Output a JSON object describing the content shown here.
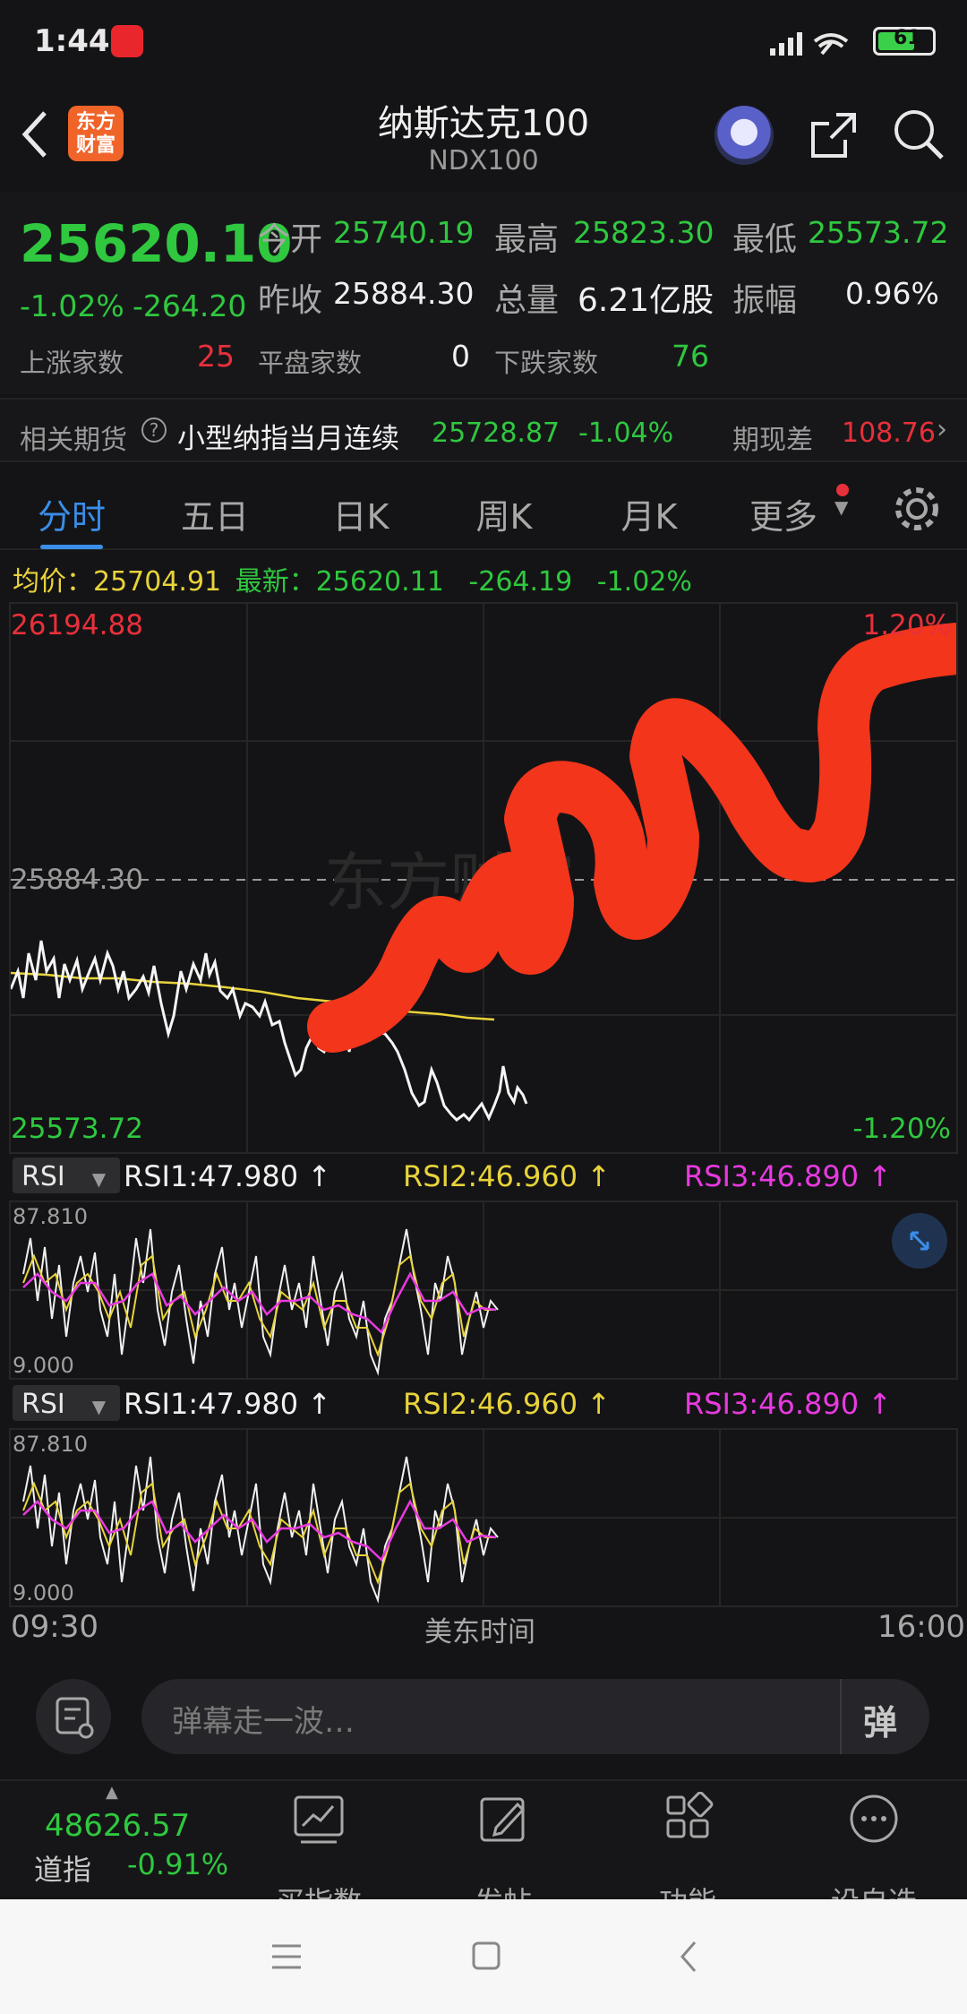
{
  "status": {
    "time": "1:44",
    "battery": "61"
  },
  "header": {
    "title": "纳斯达克100",
    "subtitle": "NDX100",
    "logo_text_1": "东方",
    "logo_text_2": "财富"
  },
  "quote": {
    "price": "25620.10",
    "change_pct": "-1.02%",
    "change_abs": "-264.20",
    "open_label": "今开",
    "open": "25740.19",
    "high_label": "最高",
    "high": "25823.30",
    "low_label": "最低",
    "low": "25573.72",
    "prev_label": "昨收",
    "prev": "25884.30",
    "vol_label": "总量",
    "vol": "6.21亿股",
    "amp_label": "振幅",
    "amp": "0.96%",
    "up_label": "上涨家数",
    "up": "25",
    "flat_label": "平盘家数",
    "flat": "0",
    "down_label": "下跌家数",
    "down": "76"
  },
  "futures": {
    "label": "相关期货",
    "name": "小型纳指当月连续",
    "price": "25728.87",
    "pct": "-1.04%",
    "basis_label": "期现差",
    "basis": "108.76"
  },
  "tabs": [
    "分时",
    "五日",
    "日K",
    "周K",
    "月K",
    "更多"
  ],
  "chart_info": {
    "avg_label": "均价：",
    "avg": "25704.91",
    "last_label": "最新：",
    "last": "25620.11",
    "chg": "-264.19",
    "pct": "-1.02%"
  },
  "chart": {
    "top_price": "26194.88",
    "mid_price": "25884.30",
    "bottom_price": "25573.72",
    "top_pct": "1.20%",
    "bottom_pct": "-1.20%",
    "watermark": "东方财富"
  },
  "rsi": {
    "selector": "RSI",
    "rsi1": "RSI1:47.980 ↑",
    "rsi2": "RSI2:46.960 ↑",
    "rsi3": "RSI3:46.890 ↑",
    "max": "87.810",
    "min": "9.000"
  },
  "time_axis": {
    "start": "09:30",
    "mid": "美东时间",
    "end": "16:00"
  },
  "danmu": {
    "placeholder": "弹幕走一波…",
    "send": "弹"
  },
  "bottom_nav": {
    "index_value": "48626.57",
    "index_name": "道指",
    "index_pct": "-0.91%",
    "items": [
      "买指数",
      "发帖",
      "功能",
      "设自选"
    ]
  },
  "colors": {
    "up": "#e8303a",
    "down": "#2fc83f",
    "accent": "#3a8ee8",
    "avg_line": "#e8d33a",
    "rsi3": "#e83ae0",
    "scribble": "#f2351b"
  }
}
